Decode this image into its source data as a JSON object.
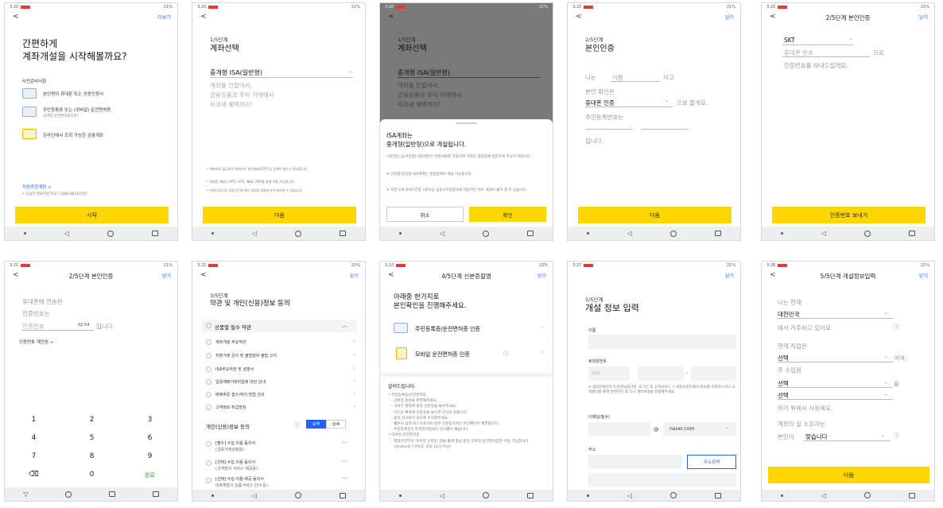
{
  "status": {
    "time1": "3:20",
    "time2": "3:21",
    "time3": "3:22",
    "time4": "3:27",
    "time5": "3:28",
    "right1": "21%",
    "right2": "22%"
  },
  "common": {
    "close": "닫기",
    "back": "<"
  },
  "s1": {
    "top_right": "더보기",
    "title_l1": "간편하게",
    "title_l2": "계좌개설을 시작해볼까요?",
    "prep_label": "사전준비사항",
    "items": [
      "본인명의 휴대폰 또는 공동인증서",
      "주민등록증 또는 (모바일) 운전면허증",
      "온라인에서 조회 가능한 금융계좌"
    ],
    "item2_sub": "모바일 운전면허증이란?",
    "help_link": "직원추천계좌 >",
    "help_note": "• 도움이 필요하신가요? 1588-6611(5번)",
    "button": "시작"
  },
  "s2": {
    "step": "1/5단계",
    "title": "계좌선택",
    "account": "중개형 ISA(일반형)",
    "desc": [
      "계좌를 만들어서,",
      "금융상품과 주식 거래에서",
      "비과세 혜택까지!"
    ],
    "notes": [
      "• 계좌에서 출금하기 위해서는 본인계좌(OTP 등) 등록이 반드시 필요합니다.",
      "• 개설된 계좌는 MTS, HTS, Web, ARS를 통해 이용 가능합니다.",
      "• 신분이상으로 사용기간에 따라 영업점 개설방식이 달라질 수 있습니다."
    ],
    "button": "다음"
  },
  "s3": {
    "step": "1/5단계",
    "title": "계좌선택",
    "account": "중개형 ISA(일반형)",
    "desc": [
      "계좌를 만들어서,",
      "금융상품과 주식 거래에서",
      "비과세 혜택까지!"
    ],
    "sheet_l1": "ISA계좌는",
    "sheet_l2": "중개형(일반형)으로 개설됩니다.",
    "sheet_p1": "(서민형),(농어민형),(청년형)은 관련서류를 지참하여 가까운 영업점에 방문하여 주시기 바랍니다.",
    "sheet_p2": "※ 신탁형/일임형 ISA계좌는 영업점에서 개설 가능합니다.",
    "sheet_p3": "※ 직전 3개 과세기간중 1회이상 금융소득종합과세 대상자인 경우 개설이 불가 할 수 있습니다.",
    "cancel": "취소",
    "confirm": "확인"
  },
  "s4": {
    "step": "2/5단계",
    "title": "본인인증",
    "l1a": "나는",
    "l1b": "이름",
    "l1c": "이고",
    "l2": "본인 확인은",
    "method": "휴대폰 인증",
    "l3": "으로 할게요.",
    "l4": "주민등록번호는",
    "l5": "입니다.",
    "button": "다음"
  },
  "s5": {
    "nav": "2/5단계 본인인증",
    "carrier": "SKT",
    "phone_ph": "휴대폰 번호",
    "suffix": "으로",
    "line2": "인증번호를 보내드릴게요.",
    "button": "인증번호 보내기"
  },
  "s6": {
    "nav": "2/5단계 본인인증",
    "l1": "휴대폰에 전송된",
    "l2": "인증번호는",
    "code_ph": "인증번호",
    "timer": "02:54",
    "l3": "입니다.",
    "resend": "인증번호 재전송 >",
    "keys": [
      "1",
      "2",
      "3",
      "4",
      "5",
      "6",
      "7",
      "8",
      "9",
      "⌫",
      "0",
      "완료"
    ]
  },
  "s7": {
    "step": "3/5단계",
    "title": "약관 및 개인(신용)정보 동의",
    "group1": "상품별 필수 약관",
    "terms": [
      "계좌개설 주요약관",
      "차명거래 금지 및 불법행위 불법 고지",
      "ISA주요약관 및 설명서",
      "일중매매거래위험에 대한 안내",
      "매매주문 접수/처리 방법 안내",
      "고객정보 취급방침"
    ],
    "group2": "개인(신용)정보 동의",
    "tab1": "요약",
    "tab2": "상세",
    "consents": [
      [
        "[필수] 수집·이용 동의서",
        "(금융거래설정용)"
      ],
      [
        "[선택] 수집·이용 동의서",
        "(고객편의 서비스 제공용)"
      ],
      [
        "[선택] 수집·이용·제공 동의서",
        "(KB계열사 상품서비스 안내 등)"
      ]
    ]
  },
  "s8": {
    "nav": "4/5단계 신분증촬영",
    "title_l1": "아래중 한가지로",
    "title_l2": "본인확인을 진행해주세요.",
    "opt1": "주민등록증/운전면허증 인증",
    "opt2": "모바일 운전면허증 인증",
    "notice": "알려드립니다.",
    "notes": [
      "• 주민등록증/운전면허증",
      "- 신분증 원본을 촬영해주세요.",
      "- 가이드 영역에 맞춰 신분증을 놓아주세요.",
      "- 어두운 배경에 신분증을 놓으면 인식이 잘됩니다.",
      "- 빛이 반사되지 않도록 주의해주세요.",
      "- 훼손이 심하거나 유효하지 않은 신분증으로는 본인확인이 제한됩니다.",
      "- 주민등록증이 운전면허증보다 인식률이 좋습니다.",
      "• 모바일 운전면허증",
      "- 행정안전부의 '모바일 신분증' 앱을 통해 발급 받은 모바일 운전면허증만 이용 가능합니다.",
      "(Android 7.0이상, iOS 14.0 이상)"
    ]
  },
  "s9": {
    "step": "5/5단계",
    "title": "개설 정보 입력",
    "name_label": "이름",
    "phone_label": "휴대폰번호",
    "phone_prefix": "010",
    "phone_note": "※ 휴대전화번호가 변경되었다면, 로그인 후 고객서비스 > 내정보관리에서 정보를 수정하시거나 고객센터를 통해 변경하신 후 다시 계좌개설을 진행해주세요.",
    "email_label": "이메일(필수)",
    "at": "@",
    "domain": "naver.com",
    "addr_label": "주소",
    "addr_button": "주소검색"
  },
  "s10": {
    "nav": "5/5단계 개설정보입력",
    "l1": "나는 현재",
    "country": "대한민국",
    "l2": "에서 거주하고 있어요.",
    "l3": "현재 직업은",
    "select": "선택",
    "l4": "이며,",
    "l5": "주 수입원",
    "l6": "을",
    "l7": "하기 위해서 사용해요.",
    "l8": "계좌의 실 소유자는",
    "l9a": "본인이",
    "l9b": "맞습니다",
    "button": "다음"
  }
}
